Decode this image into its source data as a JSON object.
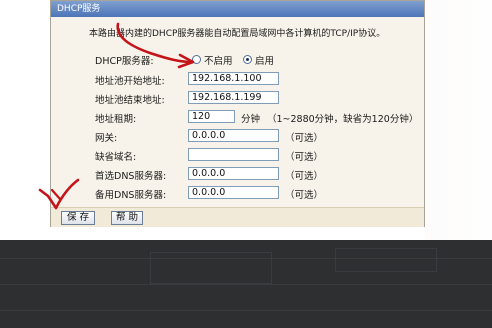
{
  "panel": {
    "title": "DHCP服务",
    "description": "本路由器内建的DHCP服务器能自动配置局域网中各计算机的TCP/IP协议。"
  },
  "dhcp_server": {
    "label": "DHCP服务器:",
    "options": [
      "不启用",
      "启用"
    ],
    "selected": "启用"
  },
  "fields": [
    {
      "label": "地址池开始地址:",
      "value": "192.168.1.100",
      "hint": ""
    },
    {
      "label": "地址池结束地址:",
      "value": "192.168.1.199",
      "hint": ""
    },
    {
      "label": "地址租期:",
      "value": "120",
      "unit": "分钟",
      "hint": "（1~2880分钟，缺省为120分钟）"
    },
    {
      "label": "网关:",
      "value": "0.0.0.0",
      "hint": "（可选）"
    },
    {
      "label": "缺省域名:",
      "value": "",
      "hint": "（可选）"
    },
    {
      "label": "首选DNS服务器:",
      "value": "0.0.0.0",
      "hint": "（可选）"
    },
    {
      "label": "备用DNS服务器:",
      "value": "0.0.0.0",
      "hint": "（可选）"
    }
  ],
  "buttons": {
    "save": "保 存",
    "help": "帮 助"
  },
  "colors": {
    "panel_bg": "#f8f3ea",
    "title_bar": "#4c74b8",
    "annotation": "#c4141a",
    "dark_area": "#2e2f31"
  }
}
